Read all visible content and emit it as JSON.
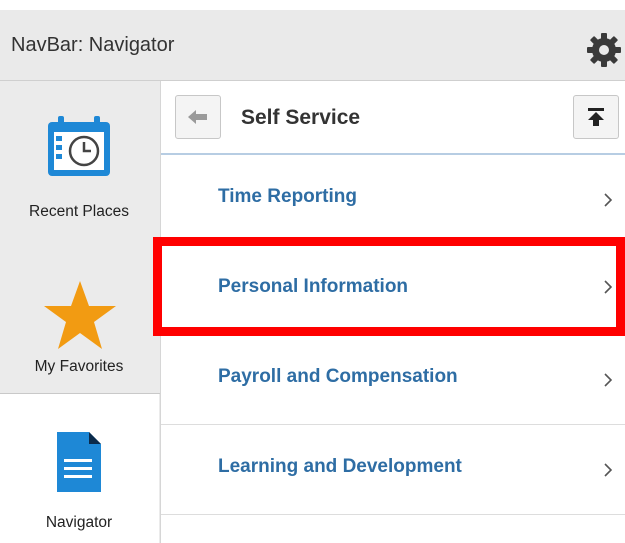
{
  "header": {
    "title": "NavBar: Navigator",
    "icon": "gear-icon"
  },
  "sidebar": {
    "items": [
      {
        "label": "Recent Places",
        "icon": "calendar-clock-icon",
        "accent": "#1e88d6"
      },
      {
        "label": "My Favorites",
        "icon": "star-icon",
        "accent": "#f29b12"
      },
      {
        "label": "Navigator",
        "icon": "document-icon",
        "accent": "#1e88d6",
        "selected": true
      }
    ]
  },
  "main": {
    "title": "Self Service",
    "back_icon": "arrow-left-icon",
    "top_icon": "arrow-to-top-icon",
    "items": [
      {
        "label": "Time Reporting"
      },
      {
        "label": "Personal Information",
        "highlighted": true
      },
      {
        "label": "Payroll and Compensation"
      },
      {
        "label": "Learning and Development"
      }
    ]
  },
  "colors": {
    "link": "#2e6da4",
    "highlight": "#ff0000",
    "header_bg": "#eaeaea",
    "sidebar_bg": "#ebebeb"
  }
}
